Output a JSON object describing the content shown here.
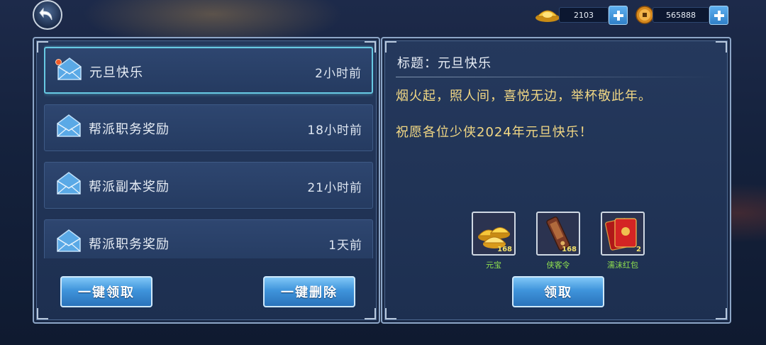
{
  "currency": {
    "gold": {
      "icon": "gold-ingot-icon",
      "value": "2103"
    },
    "coin": {
      "icon": "copper-coin-icon",
      "value": "565888"
    }
  },
  "mails": [
    {
      "title": "元旦快乐",
      "time": "2小时前",
      "unread": true,
      "selected": true
    },
    {
      "title": "帮派职务奖励",
      "time": "18小时前",
      "unread": false,
      "selected": false
    },
    {
      "title": "帮派副本奖励",
      "time": "21小时前",
      "unread": false,
      "selected": false
    },
    {
      "title": "帮派职务奖励",
      "time": "1天前",
      "unread": false,
      "selected": false
    }
  ],
  "actions": {
    "claim_all": "一键领取",
    "delete_all": "一键删除",
    "claim": "领取"
  },
  "detail": {
    "subject": "标题：元旦快乐",
    "body": [
      "烟火起，照人间，喜悦无边，举杯敬此年。",
      "祝愿各位少侠2024年元旦快乐！"
    ]
  },
  "rewards": [
    {
      "name": "元宝",
      "count": "168",
      "icon": "gold-ingots-icon"
    },
    {
      "name": "侠客令",
      "count": "168",
      "icon": "hero-token-icon"
    },
    {
      "name": "濡沫红包",
      "count": "2",
      "icon": "red-envelope-icon"
    }
  ],
  "colors": {
    "accent_blue": "#3f94db",
    "selected_border": "#67c9e3",
    "body_text": "#f2d884",
    "reward_name": "#8fe04f",
    "unread_dot": "#f05a28"
  }
}
